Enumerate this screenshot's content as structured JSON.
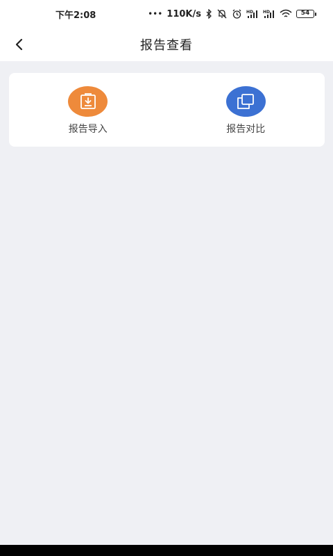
{
  "status_bar": {
    "time": "下午2:08",
    "dots": "•••",
    "network_speed": "110K/s",
    "bluetooth_icon": "bluetooth-icon",
    "mute_icon": "bell-off-icon",
    "alarm_icon": "alarm-icon",
    "signal1_label": "HD",
    "signal2_label": "HD",
    "wifi_icon": "wifi-icon",
    "battery": "54"
  },
  "nav": {
    "title": "报告查看",
    "back_icon": "chevron-left-icon"
  },
  "actions": [
    {
      "label": "报告导入",
      "icon": "import-download-icon",
      "color": "#ee8a3b"
    },
    {
      "label": "报告对比",
      "icon": "compare-copy-icon",
      "color": "#3c71d3"
    }
  ]
}
